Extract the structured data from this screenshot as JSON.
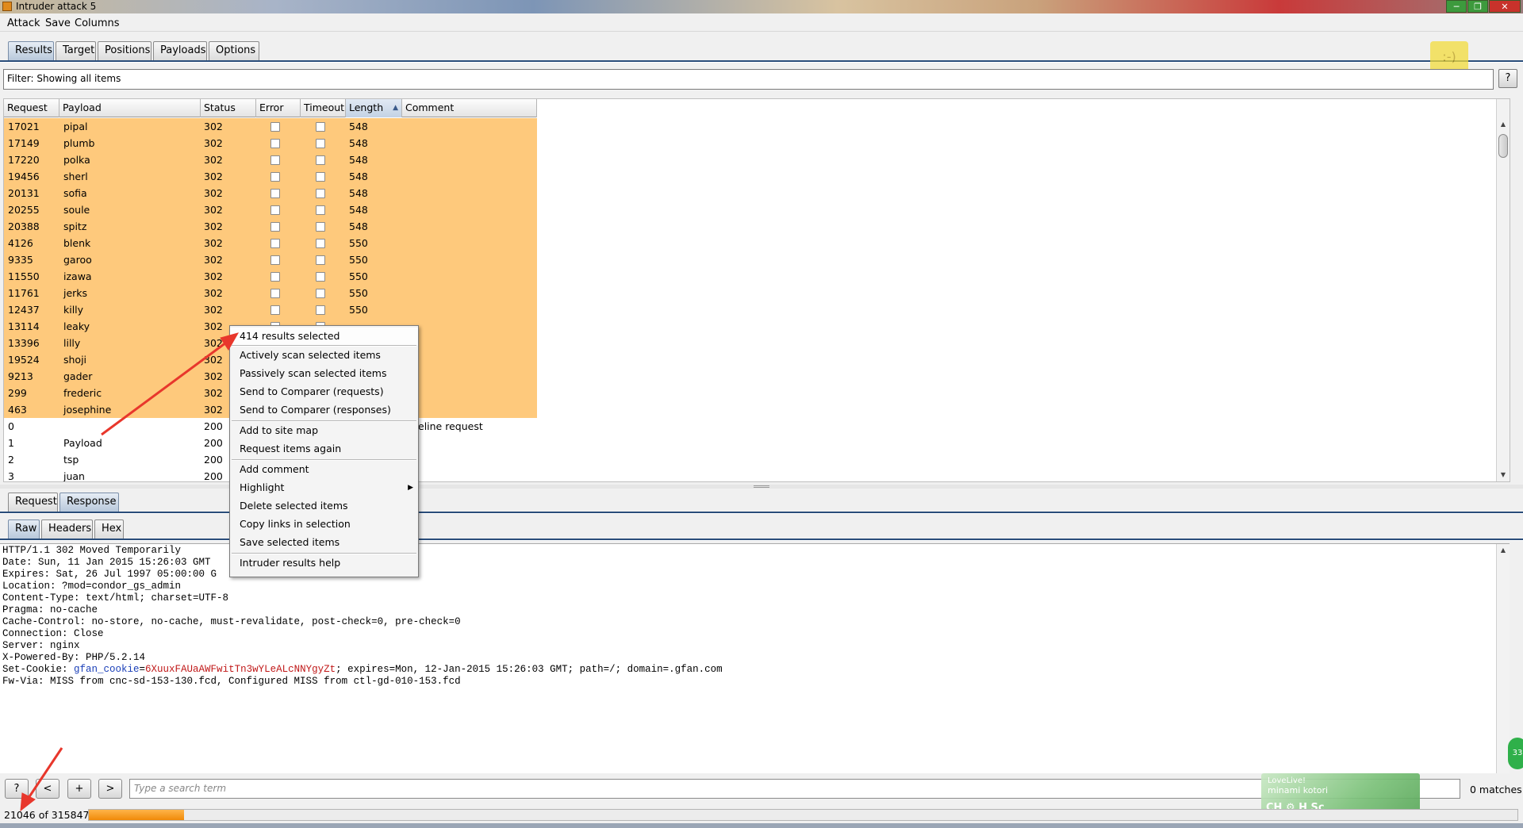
{
  "window": {
    "title": "Intruder attack 5",
    "minimize_icon": "minimize-icon",
    "maximize_icon": "restore-icon",
    "close_icon": "close-icon"
  },
  "menubar": {
    "items": [
      "Attack",
      "Save",
      "Columns"
    ]
  },
  "top_tabs": {
    "items": [
      "Results",
      "Target",
      "Positions",
      "Payloads",
      "Options"
    ],
    "active": "Results"
  },
  "filter": {
    "text": "Filter: Showing all items",
    "help_label": "?"
  },
  "table": {
    "columns": [
      "Request",
      "Payload",
      "Status",
      "Error",
      "Timeout",
      "Length",
      "Comment"
    ],
    "sorted_column": "Length",
    "sort_direction": "ascending",
    "rows": [
      {
        "request": "17021",
        "payload": "pipal",
        "status": "302",
        "length": "548",
        "comment": "",
        "highlighted": true
      },
      {
        "request": "17149",
        "payload": "plumb",
        "status": "302",
        "length": "548",
        "comment": "",
        "highlighted": true
      },
      {
        "request": "17220",
        "payload": "polka",
        "status": "302",
        "length": "548",
        "comment": "",
        "highlighted": true
      },
      {
        "request": "19456",
        "payload": "sherl",
        "status": "302",
        "length": "548",
        "comment": "",
        "highlighted": true
      },
      {
        "request": "20131",
        "payload": "sofia",
        "status": "302",
        "length": "548",
        "comment": "",
        "highlighted": true
      },
      {
        "request": "20255",
        "payload": "soule",
        "status": "302",
        "length": "548",
        "comment": "",
        "highlighted": true
      },
      {
        "request": "20388",
        "payload": "spitz",
        "status": "302",
        "length": "548",
        "comment": "",
        "highlighted": true
      },
      {
        "request": "4126",
        "payload": "blenk",
        "status": "302",
        "length": "550",
        "comment": "",
        "highlighted": true
      },
      {
        "request": "9335",
        "payload": "garoo",
        "status": "302",
        "length": "550",
        "comment": "",
        "highlighted": true
      },
      {
        "request": "11550",
        "payload": "izawa",
        "status": "302",
        "length": "550",
        "comment": "",
        "highlighted": true
      },
      {
        "request": "11761",
        "payload": "jerks",
        "status": "302",
        "length": "550",
        "comment": "",
        "highlighted": true
      },
      {
        "request": "12437",
        "payload": "killy",
        "status": "302",
        "length": "550",
        "comment": "",
        "highlighted": true
      },
      {
        "request": "13114",
        "payload": "leaky",
        "status": "302",
        "length": "",
        "comment": "",
        "highlighted": true
      },
      {
        "request": "13396",
        "payload": "lilly",
        "status": "302",
        "length": "",
        "comment": "",
        "highlighted": true
      },
      {
        "request": "19524",
        "payload": "shoji",
        "status": "302",
        "length": "",
        "comment": "",
        "highlighted": true
      },
      {
        "request": "9213",
        "payload": "gader",
        "status": "302",
        "length": "",
        "comment": "",
        "highlighted": true
      },
      {
        "request": "299",
        "payload": "frederic",
        "status": "302",
        "length": "",
        "comment": "",
        "highlighted": true
      },
      {
        "request": "463",
        "payload": "josephine",
        "status": "302",
        "length": "",
        "comment": "",
        "highlighted": true
      },
      {
        "request": "0",
        "payload": "",
        "status": "200",
        "length": "",
        "comment": "eline request",
        "highlighted": false
      },
      {
        "request": "1",
        "payload": "Payload",
        "status": "200",
        "length": "",
        "comment": "",
        "highlighted": false
      },
      {
        "request": "2",
        "payload": "tsp",
        "status": "200",
        "length": "",
        "comment": "",
        "highlighted": false
      },
      {
        "request": "3",
        "payload": "juan",
        "status": "200",
        "length": "",
        "comment": "",
        "highlighted": false
      }
    ]
  },
  "message_tabs": {
    "items": [
      "Request",
      "Response"
    ],
    "active": "Response"
  },
  "view_tabs": {
    "items": [
      "Raw",
      "Headers",
      "Hex"
    ],
    "active": "Raw"
  },
  "response": {
    "lines_before_cookie": [
      "HTTP/1.1 302 Moved Temporarily",
      "Date: Sun, 11 Jan 2015 15:26:03 GMT",
      "Expires: Sat, 26 Jul 1997 05:00:00 G",
      "Location: ?mod=condor_gs_admin",
      "Content-Type: text/html; charset=UTF-8",
      "Pragma: no-cache",
      "Cache-Control: no-store, no-cache, must-revalidate, post-check=0, pre-check=0",
      "Connection: Close",
      "Server: nginx",
      "X-Powered-By: PHP/5.2.14"
    ],
    "cookie_prefix": "Set-Cookie: ",
    "cookie_name": "gfan_cookie",
    "cookie_eq": "=",
    "cookie_value": "6XuuxFAUaAWFwitTn3wYLeALcNNYgyZt",
    "cookie_suffix": "; expires=Mon, 12-Jan-2015 15:26:03 GMT; path=/; domain=.gfan.com",
    "last_line": "Fw-Via: MISS from cnc-sd-153-130.fcd, Configured MISS from ctl-gd-010-153.fcd"
  },
  "search": {
    "help_label": "?",
    "prev_label": "<",
    "add_label": "+",
    "next_label": ">",
    "placeholder": "Type a search term",
    "matches": "0 matches"
  },
  "status": {
    "progress_text": "21046 of 315847",
    "progress_fraction": 0.0666
  },
  "context_menu": {
    "header": "414 results selected",
    "groups": [
      [
        "Actively scan selected items",
        "Passively scan selected items",
        "Send to Comparer (requests)",
        "Send to Comparer (responses)"
      ],
      [
        "Add to site map",
        "Request items again"
      ],
      [
        "Add comment",
        "Highlight",
        "Delete selected items",
        "Copy links in selection",
        "Save selected items"
      ],
      [
        "Intruder results help"
      ]
    ],
    "submenu_icon": "chevron-right-icon"
  },
  "overlays": {
    "widget_line1": "LoveLive!",
    "widget_line2": "minami kotori",
    "widget_line3": "CH ⚙ H Sc",
    "side_badge": "33",
    "smiley": ":-)"
  },
  "colors": {
    "highlight_row": "#fec97c",
    "annotation_arrow": "#e8372c",
    "progress": "#f08a08",
    "tab_border": "#2a4d7a"
  }
}
